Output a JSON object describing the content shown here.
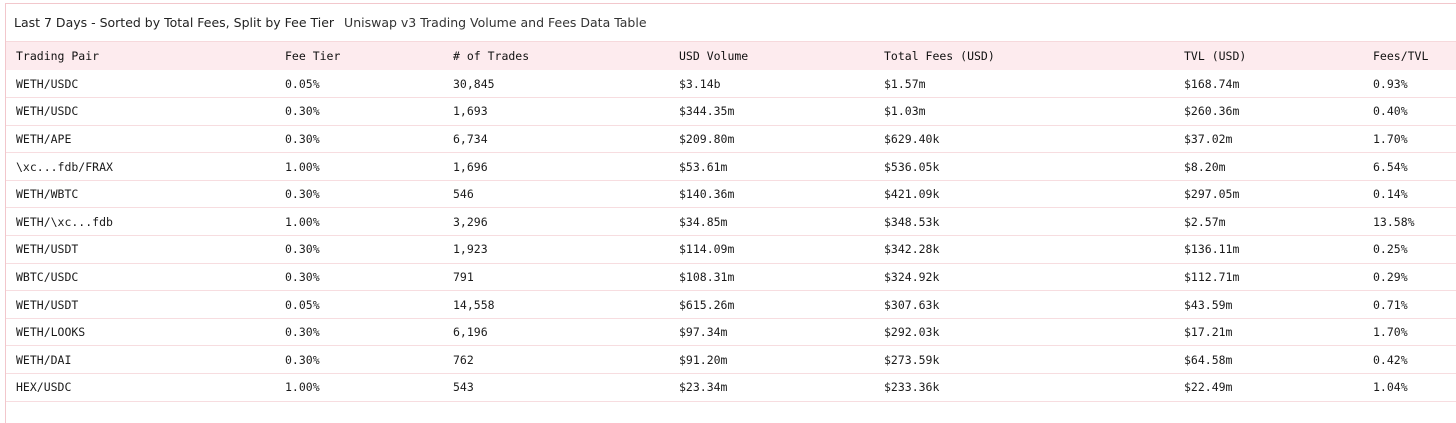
{
  "header": {
    "title": "Last 7 Days - Sorted by Total Fees, Split by Fee Tier",
    "subtitle": "Uniswap v3 Trading Volume and Fees Data Table"
  },
  "table": {
    "columns": [
      "Trading Pair",
      "Fee Tier",
      "# of Trades",
      "USD Volume",
      "Total Fees (USD)",
      "TVL (USD)",
      "Fees/TVL"
    ],
    "rows": [
      [
        "WETH/USDC",
        "0.05%",
        "30,845",
        "$3.14b",
        "$1.57m",
        "$168.74m",
        "0.93%"
      ],
      [
        "WETH/USDC",
        "0.30%",
        "1,693",
        "$344.35m",
        "$1.03m",
        "$260.36m",
        "0.40%"
      ],
      [
        "WETH/APE",
        "0.30%",
        "6,734",
        "$209.80m",
        "$629.40k",
        "$37.02m",
        "1.70%"
      ],
      [
        "\\xc...fdb/FRAX",
        "1.00%",
        "1,696",
        "$53.61m",
        "$536.05k",
        "$8.20m",
        "6.54%"
      ],
      [
        "WETH/WBTC",
        "0.30%",
        "546",
        "$140.36m",
        "$421.09k",
        "$297.05m",
        "0.14%"
      ],
      [
        "WETH/\\xc...fdb",
        "1.00%",
        "3,296",
        "$34.85m",
        "$348.53k",
        "$2.57m",
        "13.58%"
      ],
      [
        "WETH/USDT",
        "0.30%",
        "1,923",
        "$114.09m",
        "$342.28k",
        "$136.11m",
        "0.25%"
      ],
      [
        "WBTC/USDC",
        "0.30%",
        "791",
        "$108.31m",
        "$324.92k",
        "$112.71m",
        "0.29%"
      ],
      [
        "WETH/USDT",
        "0.05%",
        "14,558",
        "$615.26m",
        "$307.63k",
        "$43.59m",
        "0.71%"
      ],
      [
        "WETH/LOOKS",
        "0.30%",
        "6,196",
        "$97.34m",
        "$292.03k",
        "$17.21m",
        "1.70%"
      ],
      [
        "WETH/DAI",
        "0.30%",
        "762",
        "$91.20m",
        "$273.59k",
        "$64.58m",
        "0.42%"
      ],
      [
        "HEX/USDC",
        "1.00%",
        "543",
        "$23.34m",
        "$233.36k",
        "$22.49m",
        "1.04%"
      ]
    ]
  },
  "colors": {
    "header_bg": "#fdebee",
    "border": "#f2c7cc",
    "row_divider": "#f7dde0"
  }
}
